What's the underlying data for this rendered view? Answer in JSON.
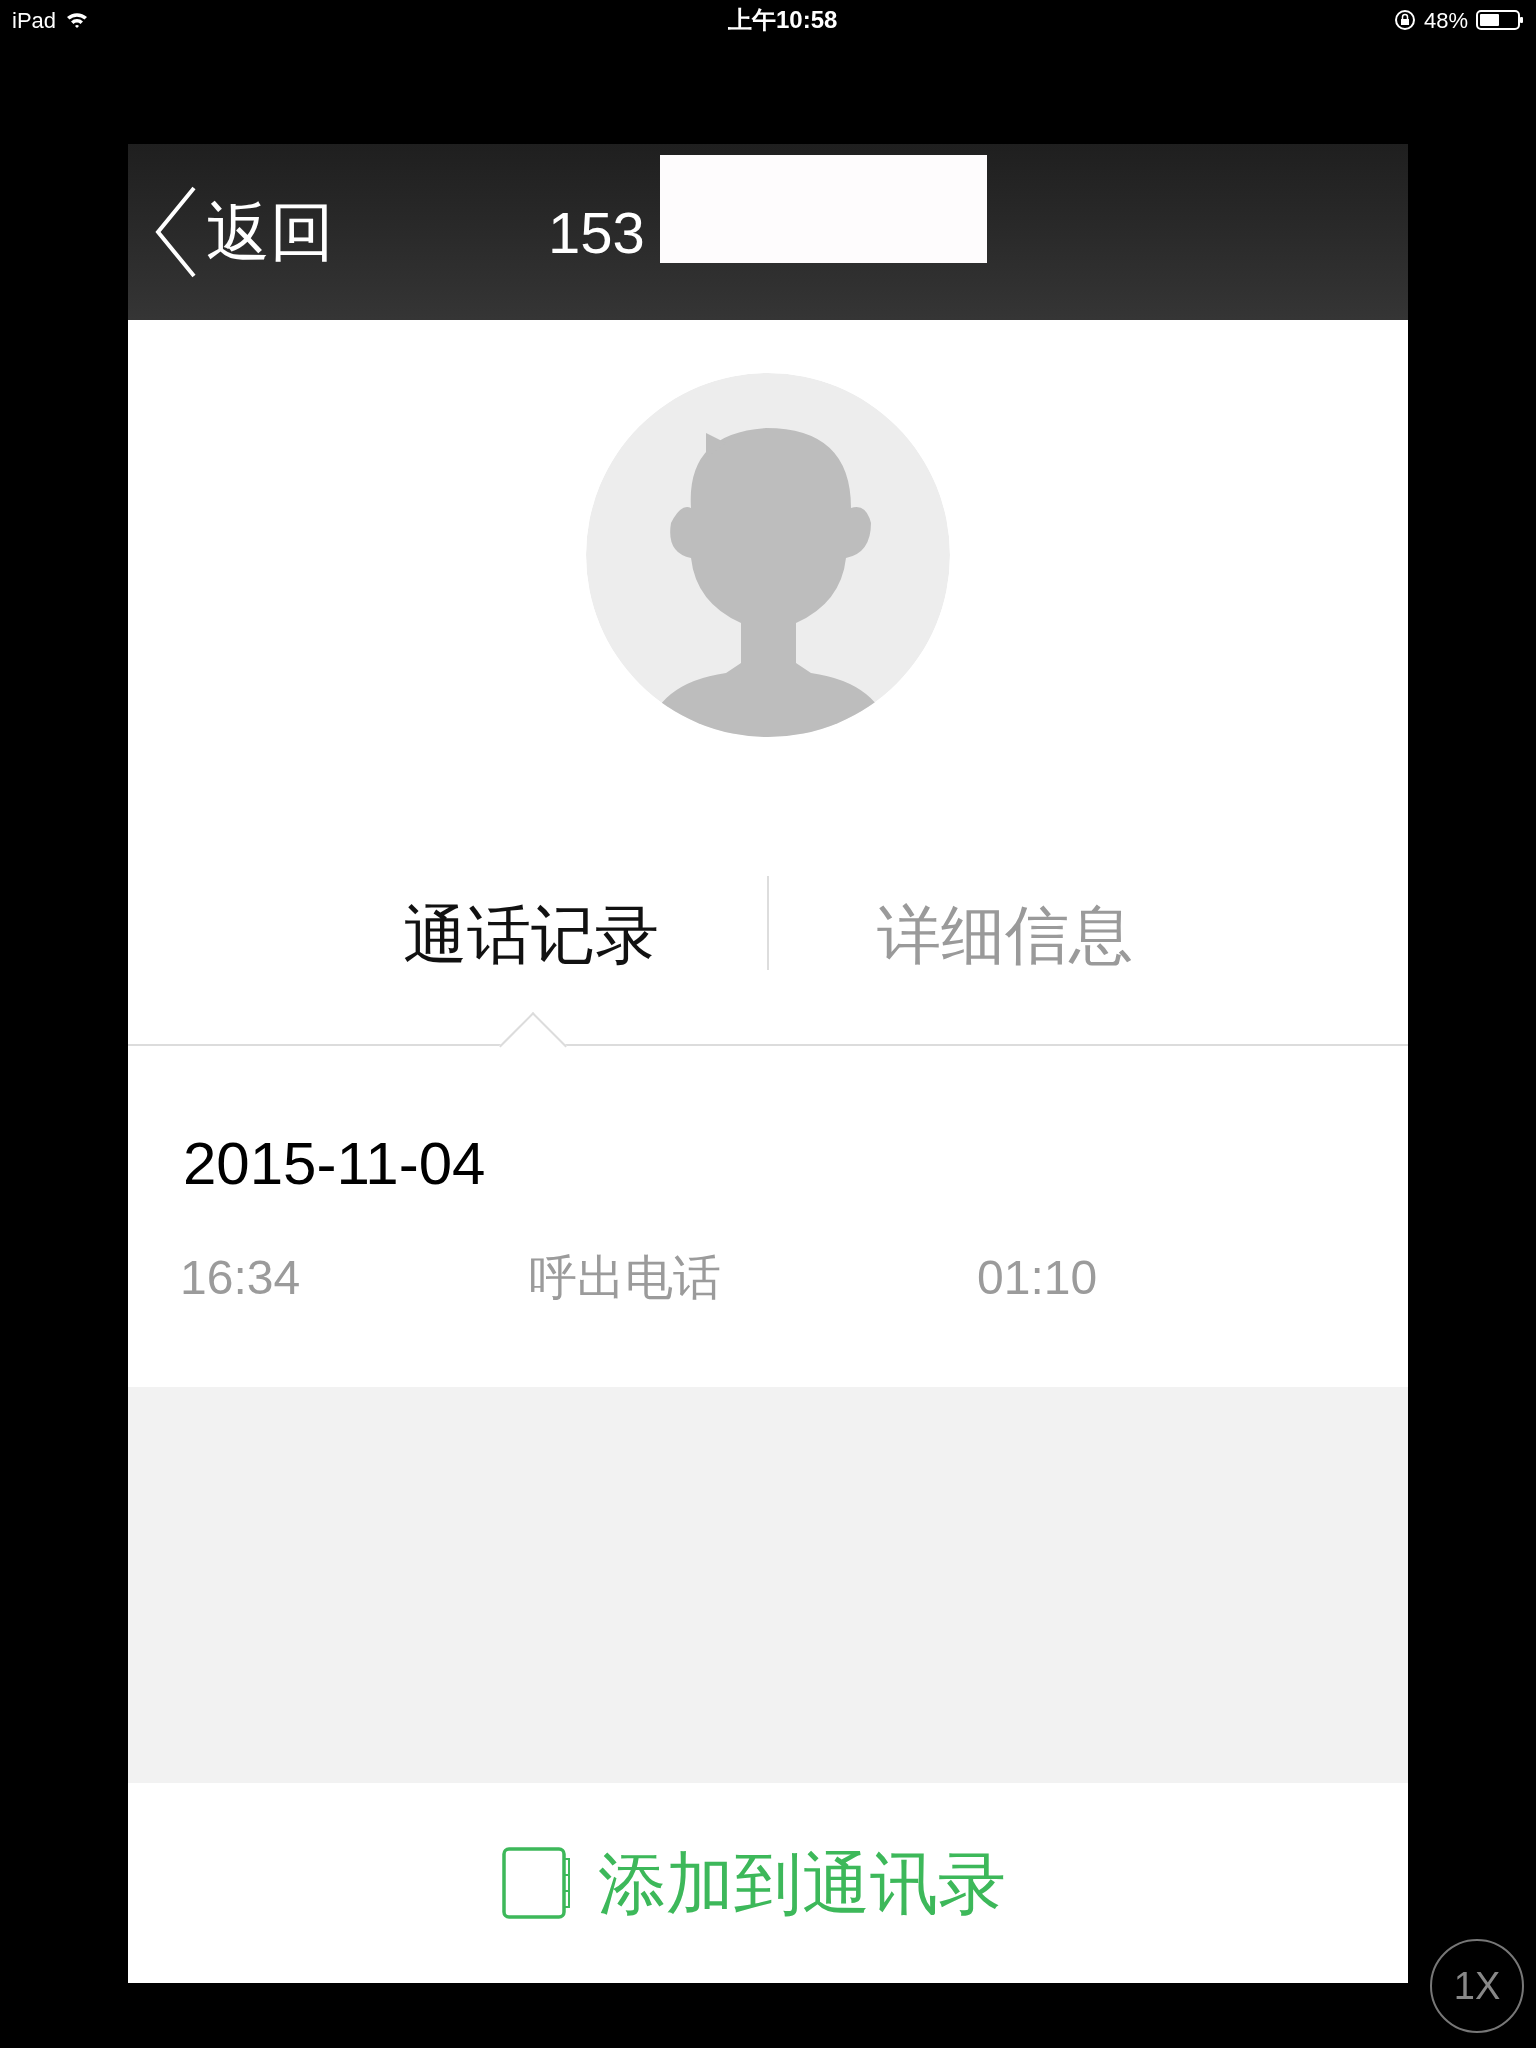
{
  "status_bar": {
    "device": "iPad",
    "time": "上午10:58",
    "battery": "48%"
  },
  "nav": {
    "back": "返回",
    "title": "153"
  },
  "tabs": [
    {
      "label": "通话记录",
      "selected": true
    },
    {
      "label": "详细信息",
      "selected": false
    }
  ],
  "call_log": [
    {
      "date": "2015-11-04",
      "calls": [
        {
          "time": "16:34",
          "type": "呼出电话",
          "duration": "01:10"
        }
      ]
    }
  ],
  "add_contact": "添加到通讯录",
  "zoom_button": "1X"
}
